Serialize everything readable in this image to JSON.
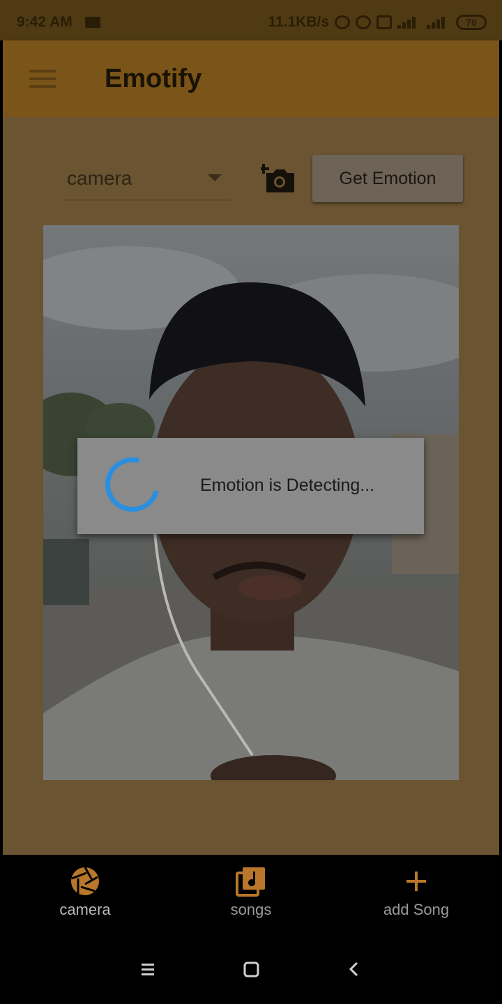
{
  "status_bar": {
    "time": "9:42 AM",
    "network_speed": "11.1KB/s",
    "battery": "76"
  },
  "app_bar": {
    "title": "Emotify",
    "menu_icon": "menu-icon"
  },
  "controls": {
    "source_dropdown_value": "camera",
    "add_photo_icon": "add-a-photo-icon",
    "get_emotion_label": "Get Emotion"
  },
  "dialog": {
    "message": "Emotion is Detecting..."
  },
  "bottom_nav": {
    "items": [
      {
        "label": "camera",
        "icon": "aperture-icon",
        "active": true
      },
      {
        "label": "songs",
        "icon": "music-library-icon",
        "active": false
      },
      {
        "label": "add Song",
        "icon": "plus-icon",
        "active": false
      }
    ]
  },
  "colors": {
    "accent_orange": "#b9772b",
    "spinner_blue": "#2a8fe0",
    "app_bar": "#7a5418"
  }
}
